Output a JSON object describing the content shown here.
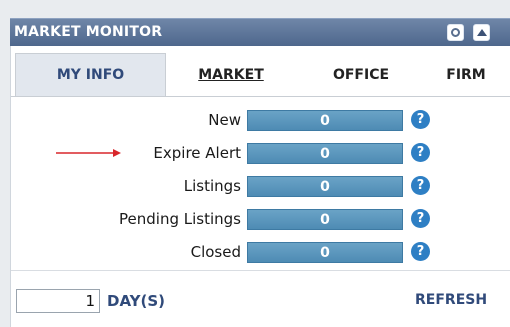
{
  "widget": {
    "title": "MARKET MONITOR",
    "icons": {
      "settings": "gear-icon",
      "collapse": "chevron-up-icon"
    }
  },
  "tabs": [
    {
      "label": "MY INFO",
      "active": true
    },
    {
      "label": "MARKET",
      "active": false
    },
    {
      "label": "OFFICE",
      "active": false
    },
    {
      "label": "FIRM",
      "active": false
    }
  ],
  "rows": [
    {
      "label": "New",
      "value": "0",
      "help": "?"
    },
    {
      "label": "Expire Alert",
      "value": "0",
      "help": "?"
    },
    {
      "label": "Listings",
      "value": "0",
      "help": "?"
    },
    {
      "label": "Pending Listings",
      "value": "0",
      "help": "?"
    },
    {
      "label": "Closed",
      "value": "0",
      "help": "?"
    }
  ],
  "footer": {
    "days_value": "1",
    "days_label": "DAY(S)",
    "refresh_label": "REFRESH"
  },
  "colors": {
    "titlebar": "#5a7196",
    "bar": "#5b97bf",
    "help": "#2e7fc4",
    "arrow": "#d8262b"
  }
}
